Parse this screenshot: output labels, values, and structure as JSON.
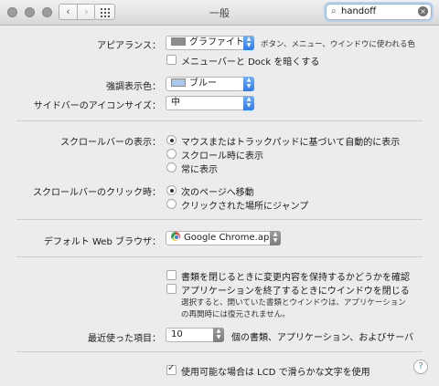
{
  "window": {
    "title": "一般"
  },
  "toolbar": {
    "back_glyph": "‹",
    "forward_glyph": "›",
    "search_value": "handoff",
    "clear_glyph": "×",
    "search_glyph": "⌕"
  },
  "appearance": {
    "label": "アピアランス：",
    "value": "グラファイト",
    "note": "ボタン、メニュー、ウインドウに使われる色",
    "dark_menu_label": "メニューバーと Dock を暗くする",
    "dark_menu_checked": false
  },
  "highlight": {
    "label": "強調表示色：",
    "value": "ブルー",
    "swatch_color": "#a9c8f0"
  },
  "sidebar_icons": {
    "label": "サイドバーのアイコンサイズ：",
    "value": "中"
  },
  "scrollbars": {
    "label": "スクロールバーの表示：",
    "options": [
      "マウスまたはトラックパッドに基づいて自動的に表示",
      "スクロール時に表示",
      "常に表示"
    ],
    "selected": 0
  },
  "scroll_click": {
    "label": "スクロールバーのクリック時：",
    "options": [
      "次のページへ移動",
      "クリックされた場所にジャンプ"
    ],
    "selected": 0
  },
  "browser": {
    "label": "デフォルト Web ブラウザ：",
    "value": "Google Chrome.app"
  },
  "documents": {
    "ask_keep_label": "書類を閉じるときに変更内容を保持するかどうかを確認",
    "ask_keep_checked": false,
    "close_windows_label": "アプリケーションを終了するときにウインドウを閉じる",
    "close_windows_checked": false,
    "note_line1": "選択すると、開いていた書類とウインドウは、アプリケーション",
    "note_line2": "の再開時には復元されません。"
  },
  "recent": {
    "label": "最近使った項目：",
    "value": "10",
    "suffix": "個の書類、アプリケーション、およびサーバ"
  },
  "lcd": {
    "label": "使用可能な場合は LCD で滑らかな文字を使用",
    "checked": true
  },
  "help": {
    "glyph": "?"
  },
  "colors": {
    "accent": "#3b7be0",
    "graphite_swatch": "#8e8e8e"
  }
}
